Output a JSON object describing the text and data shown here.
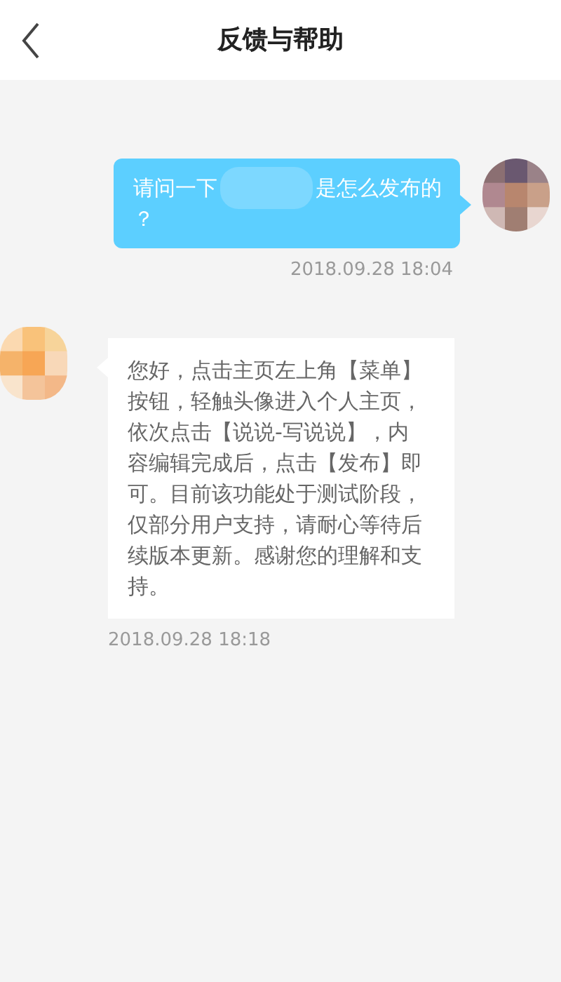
{
  "header": {
    "title": "反馈与帮助"
  },
  "messages": [
    {
      "kind": "sent",
      "parts": [
        "请问一下",
        "是怎么发布的",
        "？"
      ],
      "time": "2018.09.28 18:04"
    },
    {
      "kind": "received",
      "parts": [
        "您好，点击主页左上角【菜单】按钮，轻触头像进入个人主页，依次点击【说说-写说说】，内容编辑完成后，点击【发布】即可。目前该功能处于测试阶段，仅部分用户支持，请耐心等待后续版本更新。感谢您的理解和支持。"
      ],
      "time": "2018.09.28 18:18"
    }
  ]
}
